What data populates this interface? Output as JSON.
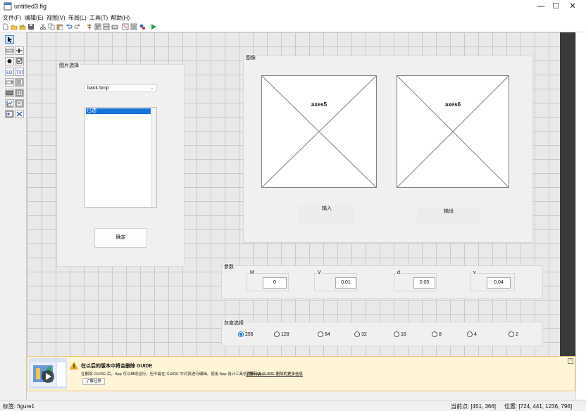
{
  "window": {
    "title": "untitled3.fig",
    "controls": {
      "minimize": "—",
      "maximize": "☐",
      "close": "✕"
    }
  },
  "menu": [
    "文件(F)",
    "编辑(E)",
    "视图(V)",
    "布局(L)",
    "工具(T)",
    "帮助(H)"
  ],
  "toolbar_icons": [
    "new-file-icon",
    "open-file-icon",
    "open-file-icon",
    "save-icon",
    "cut-icon",
    "copy-icon",
    "paste-icon",
    "undo-icon",
    "redo-icon",
    "align-icon",
    "menu-editor-icon",
    "tab-order-icon",
    "toolbar-editor-icon",
    "editor-icon",
    "property-inspector-icon",
    "object-browser-icon",
    "run-icon"
  ],
  "canvas": {
    "image_select_panel": {
      "title": "图片选择",
      "popup_value": "bank.bmp",
      "list_selected": "已选",
      "confirm_button": "确定"
    },
    "image_panel": {
      "title": "图像",
      "axes": [
        "axes5",
        "axes6"
      ],
      "labels": [
        "输入",
        "输出"
      ]
    },
    "params_panel": {
      "title": "参数",
      "fields": [
        {
          "label": "M",
          "value": "0"
        },
        {
          "label": "V",
          "value": "0.01"
        },
        {
          "label": "d",
          "value": "0.05"
        },
        {
          "label": "v",
          "value": "0.04"
        }
      ]
    },
    "gray_panel": {
      "title": "灰度选择",
      "options": [
        "256",
        "128",
        "64",
        "32",
        "16",
        "8",
        "4",
        "2"
      ],
      "selected": "256"
    }
  },
  "banner": {
    "title": "在以后的版本中将会删除 GUIDE",
    "description": "在删除 GUIDE 后，App 可以继续运行，但不能在 GUIDE 中对其进行编辑。使用 App 设计工具创建新 App。",
    "link": "了解有关 GUIDE 删除的更多信息",
    "button": "了解迁移"
  },
  "status": {
    "tag": "标签: figure1",
    "current_point": "当前点: [451, 366]",
    "position": "位置: [724, 441, 1236, 796]"
  },
  "colors": {
    "selection": "#1673d8",
    "run_icon": "#1aa34a",
    "banner_bg": "#fff4d6"
  }
}
